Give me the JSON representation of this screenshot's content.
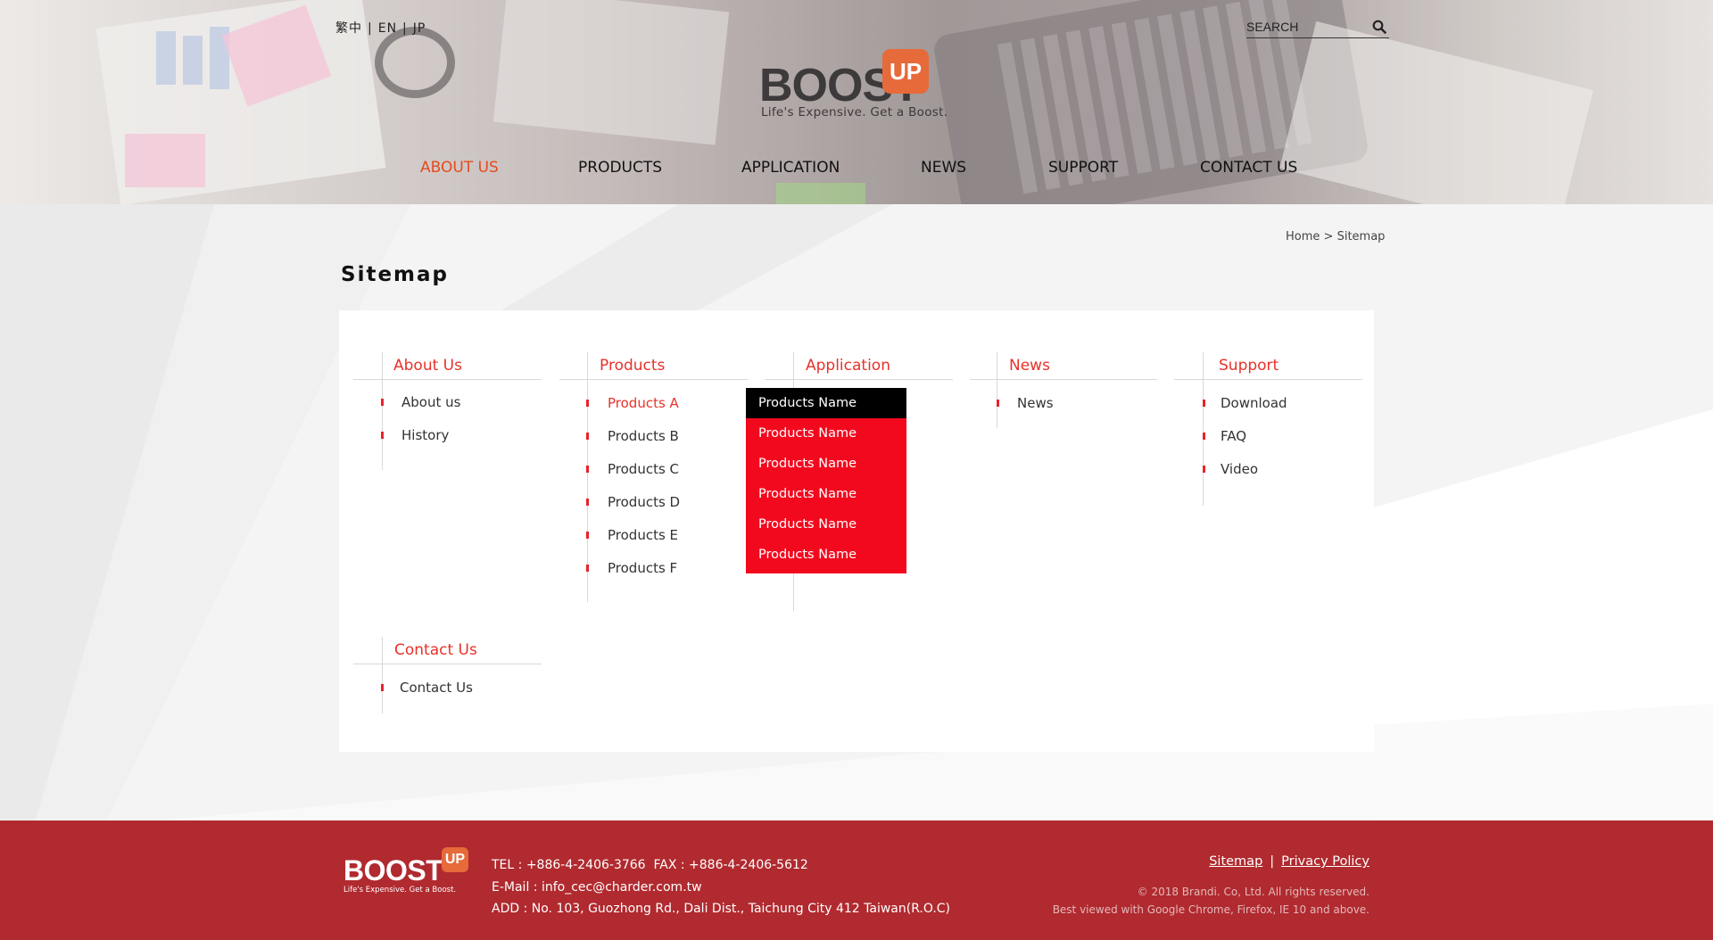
{
  "languages": [
    "繁中",
    "EN",
    "JP"
  ],
  "search": {
    "placeholder": "SEARCH"
  },
  "logo": {
    "word": "BOOST",
    "badge": "UP",
    "tagline": "Life's Expensive. Get a Boost."
  },
  "nav": [
    "ABOUT US",
    "PRODUCTS",
    "APPLICATION",
    "NEWS",
    "SUPPORT",
    "CONTACT US"
  ],
  "breadcrumb": {
    "home": "Home",
    "separator": ">",
    "current": "Sitemap"
  },
  "page_title": "Sitemap",
  "sitemap": {
    "about": {
      "title": "About Us",
      "items": [
        "About us",
        "History"
      ]
    },
    "products": {
      "title": "Products",
      "items": [
        "Products A",
        "Products B",
        "Products C",
        "Products D",
        "Products E",
        "Products F"
      ]
    },
    "application": {
      "title": "Application"
    },
    "news": {
      "title": "News",
      "items": [
        "News"
      ]
    },
    "support": {
      "title": "Support",
      "items": [
        "Download",
        "FAQ",
        "Video"
      ]
    },
    "contact": {
      "title": "Contact Us",
      "items": [
        "Contact Us"
      ]
    }
  },
  "dropdown": [
    "Products Name",
    "Products Name",
    "Products Name",
    "Products Name",
    "Products Name",
    "Products Name"
  ],
  "footer": {
    "logo_word": "BOOST",
    "logo_badge": "UP",
    "logo_tagline": "Life's Expensive. Get a Boost.",
    "contact_line": "TEL : +886-4-2406-3766  FAX : +886-4-2406-5612",
    "email_line": "E-Mail : info_cec@charder.com.tw",
    "address_line": "ADD : No. 103, Guozhong Rd., Dali Dist., Taichung City 412 Taiwan(R.O.C)",
    "links": [
      "Sitemap",
      "Privacy Policy"
    ],
    "link_separator": "|",
    "copyright": "© 2018 Brandi. Co, Ltd. All rights reserved.",
    "browsers": "Best viewed with Google Chrome, Firefox, IE 10 and above."
  },
  "colors": {
    "accent": "#e8322a",
    "nav_active": "#e44b1f",
    "dropdown": "#f3091e",
    "footer": "#b02a2f",
    "logo_badge": "#e66a3a"
  }
}
